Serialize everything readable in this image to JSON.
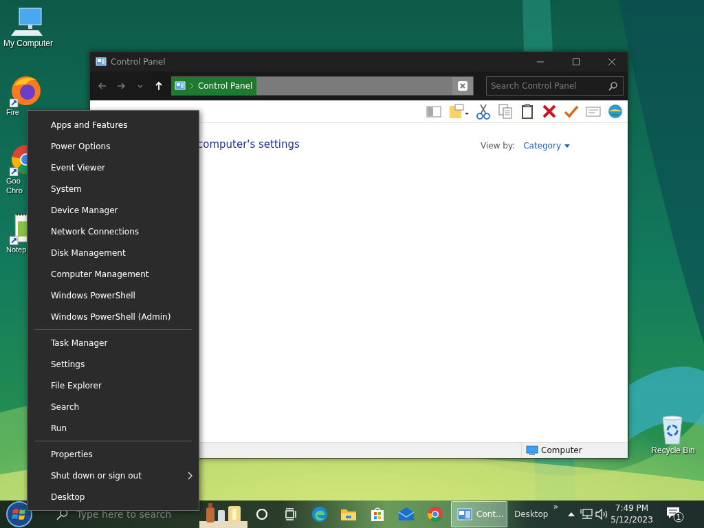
{
  "desktop_icons": [
    {
      "kind": "computer",
      "lines": [
        "My Computer"
      ]
    },
    {
      "kind": "firefox",
      "lines": [
        "Fire"
      ]
    },
    {
      "kind": "chrome",
      "lines": [
        "Goo",
        "Chro"
      ]
    },
    {
      "kind": "notepad",
      "lines": [
        "Notep"
      ]
    },
    {
      "kind": "recycle",
      "lines": [
        "Recycle Bin"
      ]
    }
  ],
  "window": {
    "title": "Control Panel",
    "address": {
      "crumbs": [
        "Control Panel"
      ]
    },
    "search": {
      "placeholder": "Search Control Panel"
    },
    "heading": "computer's settings",
    "view_by": {
      "label": "View by:",
      "value": "Category"
    },
    "status_bar": {
      "text": "Computer"
    }
  },
  "context_menu": {
    "groups": [
      [
        {
          "label": "Apps and Features",
          "submenu": false
        },
        {
          "label": "Power Options",
          "submenu": false
        },
        {
          "label": "Event Viewer",
          "submenu": false
        },
        {
          "label": "System",
          "submenu": false
        },
        {
          "label": "Device Manager",
          "submenu": false
        },
        {
          "label": "Network Connections",
          "submenu": false
        },
        {
          "label": "Disk Management",
          "submenu": false
        },
        {
          "label": "Computer Management",
          "submenu": false
        },
        {
          "label": "Windows PowerShell",
          "submenu": false
        },
        {
          "label": "Windows PowerShell (Admin)",
          "submenu": false
        }
      ],
      [
        {
          "label": "Task Manager",
          "submenu": false
        },
        {
          "label": "Settings",
          "submenu": false
        },
        {
          "label": "File Explorer",
          "submenu": false
        },
        {
          "label": "Search",
          "submenu": false
        },
        {
          "label": "Run",
          "submenu": false
        }
      ],
      [
        {
          "label": "Properties",
          "submenu": false
        },
        {
          "label": "Shut down or sign out",
          "submenu": true
        },
        {
          "label": "Desktop",
          "submenu": false
        }
      ]
    ]
  },
  "taskbar": {
    "search": {
      "placeholder": "Type here to search"
    },
    "pinned": [
      {
        "kind": "edge"
      },
      {
        "kind": "explorer"
      },
      {
        "kind": "store"
      },
      {
        "kind": "mail"
      },
      {
        "kind": "chrome"
      }
    ],
    "task_button": {
      "label": "Cont...",
      "active": true
    },
    "toolbar": {
      "label": "Desktop",
      "more": "»"
    },
    "clock": {
      "time": "7:49 PM",
      "date": "5/12/2023"
    },
    "notifications": {
      "count": "1"
    }
  }
}
